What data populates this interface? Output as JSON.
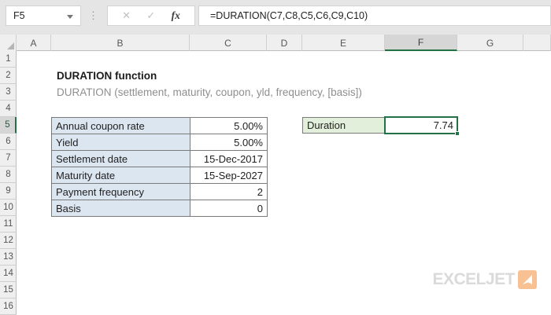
{
  "name_box": {
    "value": "F5"
  },
  "formula_bar": {
    "separator_icon": "⋮",
    "cancel_icon": "✕",
    "enter_icon": "✓",
    "fx_icon": "fx",
    "formula": "=DURATION(C7,C8,C5,C6,C9,C10)"
  },
  "grid": {
    "column_headers": [
      "A",
      "B",
      "C",
      "D",
      "E",
      "F",
      "G"
    ],
    "row_headers": [
      "1",
      "2",
      "3",
      "4",
      "5",
      "6",
      "7",
      "8",
      "9",
      "10",
      "11",
      "12",
      "13",
      "14",
      "15",
      "16"
    ],
    "selected_cell": "F5",
    "selected_column": "F",
    "selected_row": "5"
  },
  "sheet": {
    "title": "DURATION function",
    "syntax": "DURATION (settlement, maturity, coupon, yld, frequency, [basis])",
    "input_table": [
      {
        "label": "Annual coupon rate",
        "value": "5.00%"
      },
      {
        "label": "Yield",
        "value": "5.00%"
      },
      {
        "label": "Settlement date",
        "value": "15-Dec-2017"
      },
      {
        "label": "Maturity date",
        "value": "15-Sep-2027"
      },
      {
        "label": "Payment frequency",
        "value": "2"
      },
      {
        "label": "Basis",
        "value": "0"
      }
    ],
    "result": {
      "label": "Duration",
      "value": "7.74"
    }
  },
  "logo": {
    "text": "EXCELJET",
    "icon": "paper-plane-icon"
  },
  "colors": {
    "accent_green": "#217346",
    "input_fill": "#dce6f1",
    "result_fill": "#e2efda",
    "logo_orange": "#f7c193",
    "logo_gray": "#dadada"
  }
}
